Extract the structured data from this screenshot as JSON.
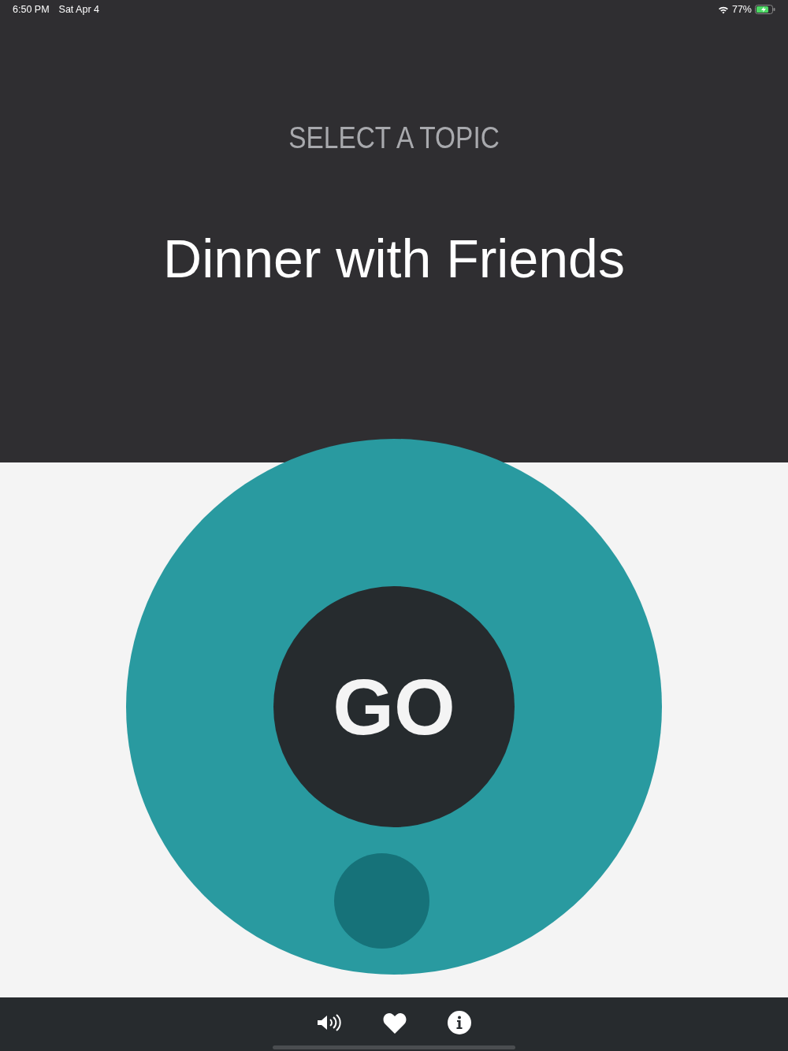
{
  "status_bar": {
    "time": "6:50 PM",
    "date": "Sat Apr 4",
    "battery": "77%"
  },
  "header": {
    "label": "SELECT A TOPIC",
    "topic": "Dinner with Friends"
  },
  "dial": {
    "button": "GO"
  }
}
